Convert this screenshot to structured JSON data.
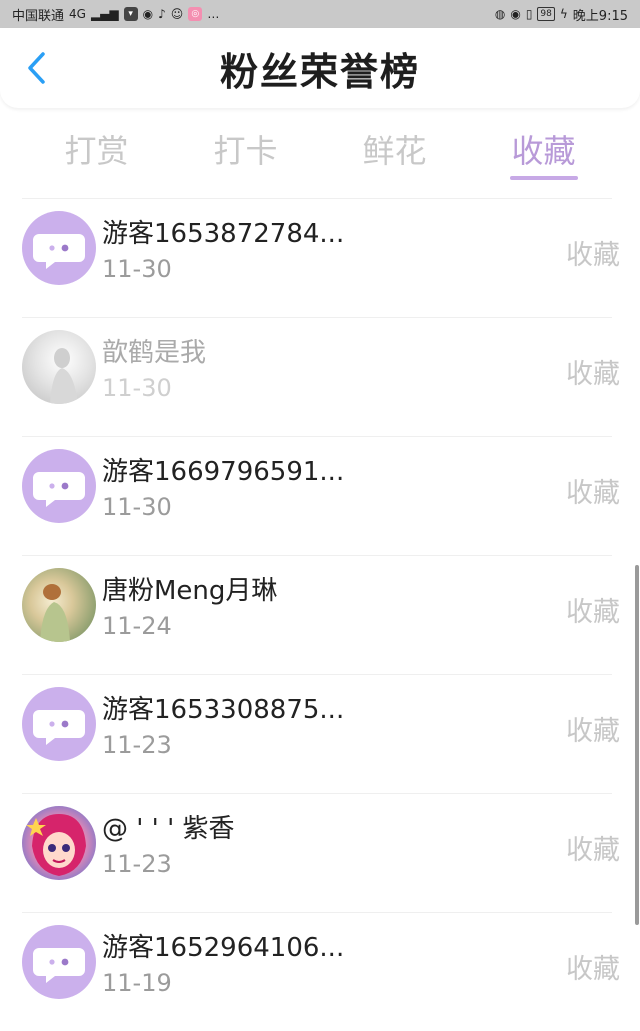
{
  "status_bar": {
    "carrier": "中国联通",
    "network": "4G",
    "more": "…",
    "battery": "98",
    "time": "晚上9:15"
  },
  "header": {
    "title": "粉丝荣誉榜",
    "back_icon": "chevron-left-icon",
    "accent_color": "#2a9ff5"
  },
  "tabs": [
    {
      "label": "打赏",
      "active": false
    },
    {
      "label": "打卡",
      "active": false
    },
    {
      "label": "鲜花",
      "active": false
    },
    {
      "label": "收藏",
      "active": true
    }
  ],
  "colors": {
    "tab_active": "#b89ad8",
    "tab_inactive": "#c8c8c8",
    "default_avatar": "#cbb0ec"
  },
  "fans": [
    {
      "name": "游客1653872784...",
      "date": "11-30",
      "action": "收藏",
      "avatar": "default-chat-avatar",
      "dim": false
    },
    {
      "name": "歆鹤是我",
      "date": "11-30",
      "action": "收藏",
      "avatar": "photo-avatar",
      "dim": true
    },
    {
      "name": "游客1669796591...",
      "date": "11-30",
      "action": "收藏",
      "avatar": "default-chat-avatar",
      "dim": false
    },
    {
      "name": "唐粉Meng月琳",
      "date": "11-24",
      "action": "收藏",
      "avatar": "photo-avatar",
      "dim": false
    },
    {
      "name": "游客1653308875...",
      "date": "11-23",
      "action": "收藏",
      "avatar": "default-chat-avatar",
      "dim": false
    },
    {
      "name": "@ ' ' ' 紫香",
      "date": "11-23",
      "action": "收藏",
      "avatar": "cartoon-avatar",
      "dim": false
    },
    {
      "name": "游客1652964106...",
      "date": "11-19",
      "action": "收藏",
      "avatar": "default-chat-avatar",
      "dim": false
    }
  ]
}
